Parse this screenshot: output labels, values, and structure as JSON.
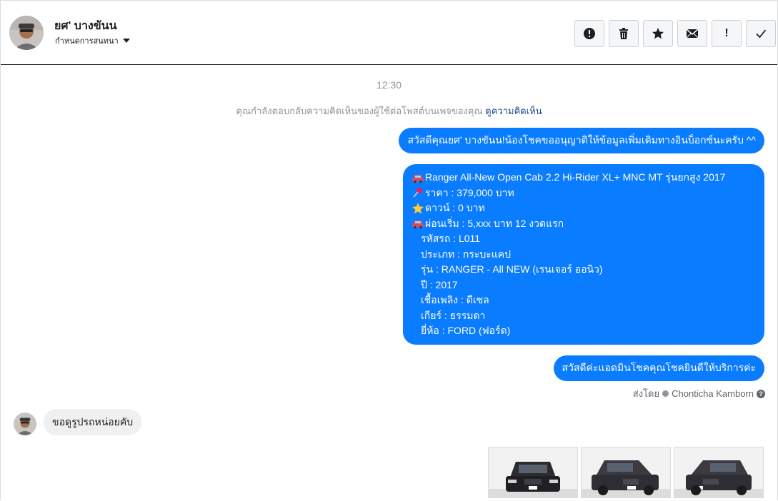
{
  "header": {
    "contact_name": "ยศ' บางขันน",
    "assign_label": "กำหนดการสนทนา",
    "actions": [
      {
        "icon": "alert-circle-icon",
        "name": "mark-spam-button"
      },
      {
        "icon": "trash-icon",
        "name": "delete-button"
      },
      {
        "icon": "star-icon",
        "name": "star-button"
      },
      {
        "icon": "envelope-icon",
        "name": "mark-unread-button"
      },
      {
        "icon": "exclamation-icon",
        "name": "follow-up-button",
        "text": "!"
      },
      {
        "icon": "checkmark-icon",
        "name": "mark-done-button"
      }
    ]
  },
  "thread": {
    "timestamp": "12:30",
    "notice_text": "คุณกำลังตอบกลับความคิดเห็นของผู้ใช้ต่อโพสต์บนเพจของคุณ ",
    "notice_link": "ดูความคิดเห็น",
    "msg1": "สวัสดีคุณยศ' บางขันน!น้องโชคขออนุญาติให้ข้อมูลเพิ่มเติมทางอินบ็อกซ์นะครับ ^^",
    "msg2": {
      "title": "Ranger All-New Open Cab 2.2 Hi-Rider XL+ MNC MT รุ่นยกสูง 2017",
      "price": "ราคา : 379,000 บาท",
      "down": "ดาวน์ : 0 บาท",
      "installment": "ผ่อนเริ่ม : 5,xxx บาท 12 งวดแรก",
      "code": "รหัสรถ : L011",
      "type": "ประเภท : กระบะแคป",
      "model": "รุ่น : RANGER - All NEW (เรนเจอร์ ออนิว)",
      "year": "ปี : 2017",
      "fuel": "เชื้อเพลิง : ดีเซล",
      "gear": "เกียร์ : ธรรมดา",
      "brand": "ยี่ห้อ : FORD (ฟอร์ด)"
    },
    "msg3": "สวัสดีค่ะแอดมินโชคคุณโชคยินดีให้บริการค่ะ",
    "sent_by_label": "ส่งโดย",
    "sent_by_name": "Chonticha Kamborn",
    "incoming": "ขอดูรูปรถหน่อยคับ"
  },
  "colors": {
    "outgoing_bubble": "#0a7cff",
    "incoming_bubble": "#f1f0f0",
    "link": "#1c4a8c",
    "muted_text": "#90949c"
  }
}
